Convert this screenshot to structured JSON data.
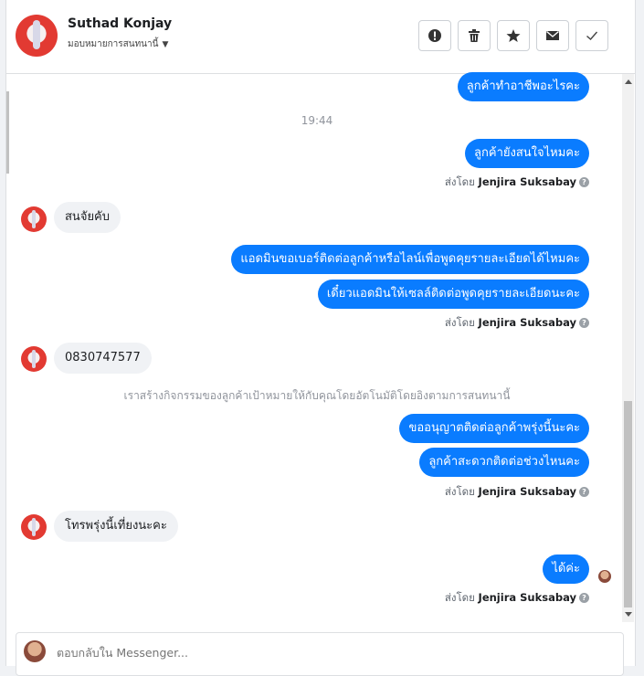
{
  "header": {
    "contact_name": "Suthad Konjay",
    "assign_label": "มอบหมายการสนทนานี้",
    "actions": [
      {
        "icon": "alert-icon"
      },
      {
        "icon": "trash-icon"
      },
      {
        "icon": "star-icon"
      },
      {
        "icon": "envelope-icon"
      },
      {
        "icon": "check-icon"
      }
    ]
  },
  "messages": {
    "m1": "ลูกค้าทำอาชีพอะไรคะ",
    "time1": "19:44",
    "m2": "ลูกค้ายังสนใจไหมคะ",
    "sent_prefix": "ส่งโดย",
    "agent": "Jenjira Suksabay",
    "in1": "สนจัยคับ",
    "m3": "แอดมินขอเบอร์ติดต่อลูกค้าหรือไลน์เพื่อพูดคุยรายละเอียดได้ไหมคะ",
    "m4": "เดี๋ยวแอดมินให้เซลล์ติดต่อพูดคุยรายละเอียดนะคะ",
    "in2": "0830747577",
    "system_note": "เราสร้างกิจกรรมของลูกค้าเป้าหมายให้กับคุณโดยอัตโนมัติโดยอิงตามการสนทนานี้",
    "m5": "ขออนุญาตติดต่อลูกค้าพรุ่งนี้นะคะ",
    "m6": "ลูกค้าสะดวกติดต่อช่วงไหนคะ",
    "in3": "โทรพรุ่งนี้เที่ยงนะคะ",
    "m7": "ได้ค่ะ"
  },
  "composer": {
    "placeholder": "ตอบกลับใน Messenger..."
  }
}
